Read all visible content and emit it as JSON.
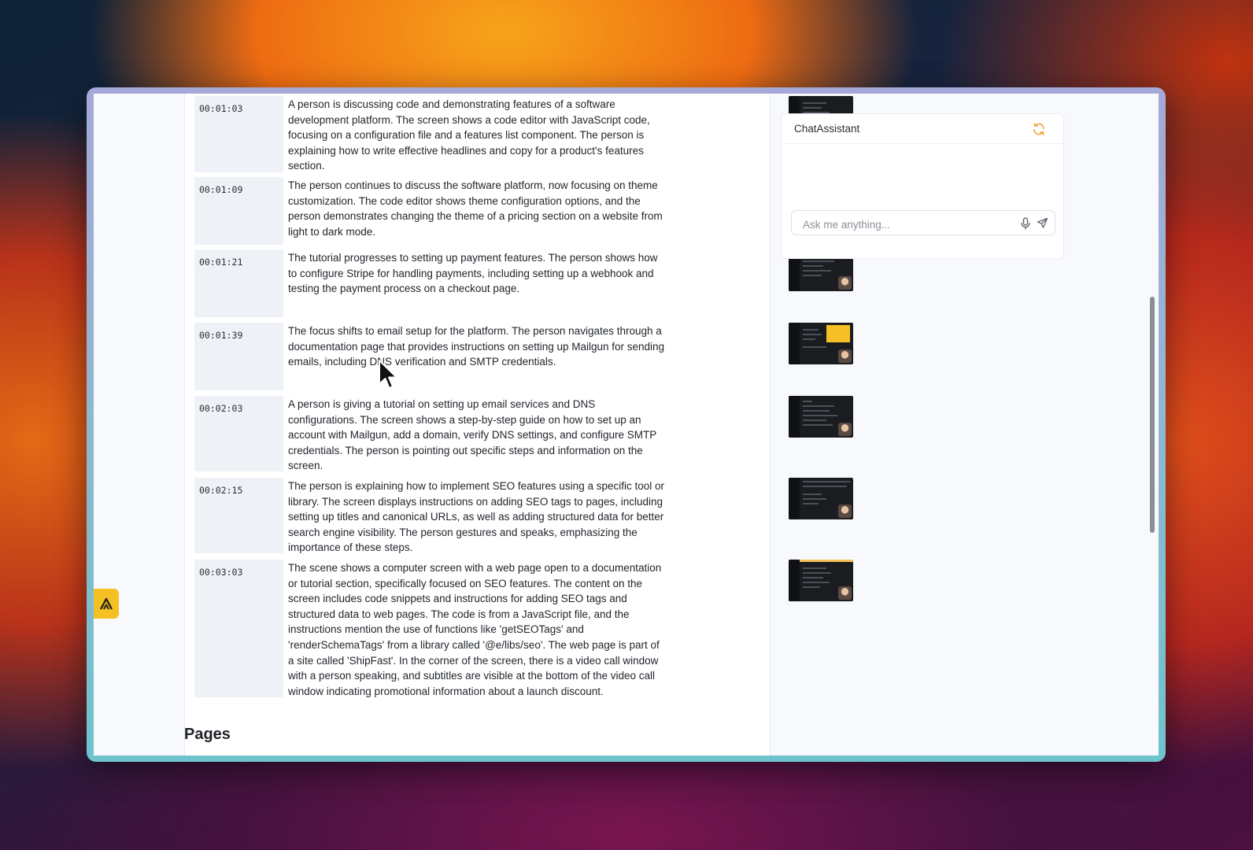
{
  "chat": {
    "title": "ChatAssistant",
    "input_placeholder": "Ask me anything...",
    "accent_color": "#f2a33a"
  },
  "transcript": {
    "segments": [
      {
        "time": "00:01:03",
        "text": "A person is discussing code and demonstrating features of a software development platform. The screen shows a code editor with JavaScript code, focusing on a configuration file and a features list component. The person is explaining how to write effective headlines and copy for a product's features section."
      },
      {
        "time": "00:01:09",
        "text": "The person continues to discuss the software platform, now focusing on theme customization. The code editor shows theme configuration options, and the person demonstrates changing the theme of a pricing section on a website from light to dark mode."
      },
      {
        "time": "00:01:21",
        "text": "The tutorial progresses to setting up payment features. The person shows how to configure Stripe for handling payments, including setting up a webhook and testing the payment process on a checkout page."
      },
      {
        "time": "00:01:39",
        "text": "The focus shifts to email setup for the platform. The person navigates through a documentation page that provides instructions on setting up Mailgun for sending emails, including DNS verification and SMTP credentials."
      },
      {
        "time": "00:02:03",
        "text": "A person is giving a tutorial on setting up email services and DNS configurations. The screen shows a step-by-step guide on how to set up an account with Mailgun, add a domain, verify DNS settings, and configure SMTP credentials. The person is pointing out specific steps and information on the screen."
      },
      {
        "time": "00:02:15",
        "text": "The person is explaining how to implement SEO features using a specific tool or library. The screen displays instructions on adding SEO tags to pages, including setting up titles and canonical URLs, as well as adding structured data for better search engine visibility. The person gestures and speaks, emphasizing the importance of these steps."
      },
      {
        "time": "00:03:03",
        "text": "The scene shows a computer screen with a web page open to a documentation or tutorial section, specifically focused on SEO features. The content on the screen includes code snippets and instructions for adding SEO tags and structured data to web pages. The code is from a JavaScript file, and the instructions mention the use of functions like 'getSEOTags' and 'renderSchemaTags' from a library called '@e/libs/seo'. The web page is part of a site called 'ShipFast'. In the corner of the screen, there is a video call window with a person speaking, and subtitles are visible at the bottom of the video call window indicating promotional information about a launch discount."
      }
    ]
  },
  "pages_heading": "Pages",
  "icons": {
    "refresh": "refresh-icon",
    "mic": "microphone-icon",
    "send": "send-icon",
    "fab": "app-logo-icon"
  }
}
